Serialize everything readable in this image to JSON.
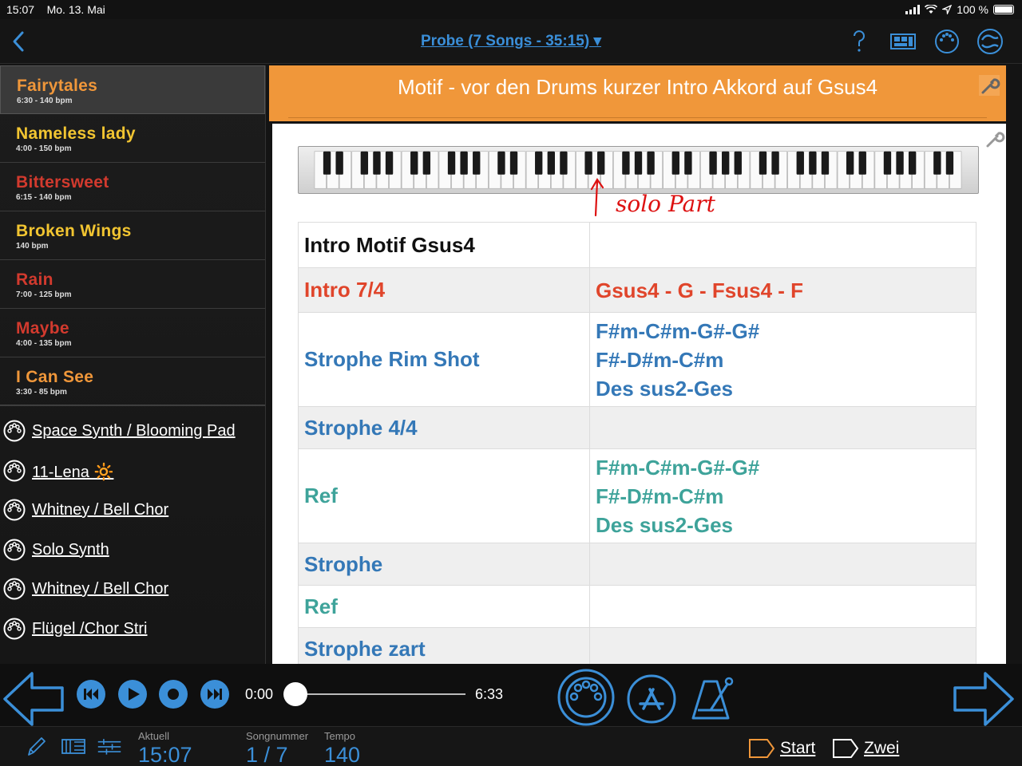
{
  "status": {
    "time": "15:07",
    "date": "Mo. 13. Mai",
    "battery": "100 %"
  },
  "nav": {
    "title": "Probe (7 Songs - 35:15) ▾"
  },
  "songs": [
    {
      "name": "Fairytales",
      "meta": "6:30 - 140 bpm",
      "color": "#f0973a",
      "active": true
    },
    {
      "name": "Nameless lady",
      "meta": "4:00 - 150 bpm",
      "color": "#f2c531"
    },
    {
      "name": "Bittersweet",
      "meta": "6:15 - 140 bpm",
      "color": "#d23a2e"
    },
    {
      "name": "Broken Wings",
      "meta": "140 bpm",
      "color": "#f2c531"
    },
    {
      "name": "Rain",
      "meta": "7:00 - 125 bpm",
      "color": "#d23a2e"
    },
    {
      "name": "Maybe",
      "meta": "4:00 - 135 bpm",
      "color": "#d23a2e"
    },
    {
      "name": "I Can See",
      "meta": "3:30 - 85 bpm",
      "color": "#f0973a"
    }
  ],
  "presets": [
    "Space Synth / Blooming Pad",
    "11-Lena 🔆",
    "Whitney / Bell Chor",
    "Solo Synth",
    "Whitney / Bell Chor",
    "Flügel /Chor Stri"
  ],
  "header": {
    "title": "Motif - vor den Drums kurzer Intro Akkord auf Gsus4"
  },
  "annotation": "solo Part",
  "chart_rows": [
    {
      "left": "Intro Motif Gsus4",
      "right": [],
      "color": "black",
      "gray": false
    },
    {
      "left": "Intro 7/4",
      "right": [
        "Gsus4 - G - Fsus4 - F"
      ],
      "color": "red",
      "gray": true
    },
    {
      "left": "Strophe Rim Shot",
      "right": [
        "F#m-C#m-G#-G#",
        "F#-D#m-C#m",
        "Des sus2-Ges"
      ],
      "color": "blue",
      "gray": false
    },
    {
      "left": "Strophe 4/4",
      "right": [],
      "color": "blue",
      "gray": true
    },
    {
      "left": "Ref",
      "right": [
        "F#m-C#m-G#-G#",
        "F#-D#m-C#m",
        "Des sus2-Ges"
      ],
      "color": "teal",
      "gray": false
    },
    {
      "left": "Strophe",
      "right": [],
      "color": "blue",
      "gray": true
    },
    {
      "left": "Ref",
      "right": [],
      "color": "teal",
      "gray": false
    },
    {
      "left": "Strophe zart",
      "right": [],
      "color": "blue",
      "gray": true
    }
  ],
  "transport": {
    "current": "0:00",
    "total": "6:33",
    "progress": 0.0
  },
  "footer": {
    "aktuell_label": "Aktuell",
    "aktuell_value": "15:07",
    "songnummer_label": "Songnummer",
    "songnummer_value": "1 / 7",
    "tempo_label": "Tempo",
    "tempo_value": "140",
    "start_label": "Start",
    "zwei_label": "Zwei"
  },
  "colors": {
    "accent": "#3b8fd8",
    "header": "#f0973a"
  }
}
